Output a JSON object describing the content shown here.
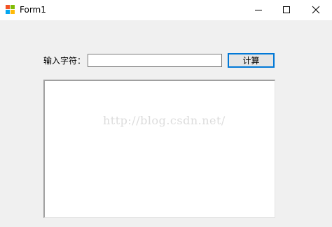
{
  "window": {
    "title": "Form1",
    "icon": "winforms-app-icon",
    "controls": {
      "minimize_icon": "minimize-icon",
      "maximize_icon": "maximize-icon",
      "close_icon": "close-icon"
    }
  },
  "form": {
    "input_label": "输入字符：",
    "input_value": "",
    "button_label": "计算",
    "output_text": ""
  },
  "watermark": {
    "text": "http://blog.csdn.net/"
  },
  "colors": {
    "form_background": "#f0f0f0",
    "titlebar_background": "#ffffff",
    "button_focus_border": "#0078d7",
    "watermark": "#dcdcdc"
  }
}
